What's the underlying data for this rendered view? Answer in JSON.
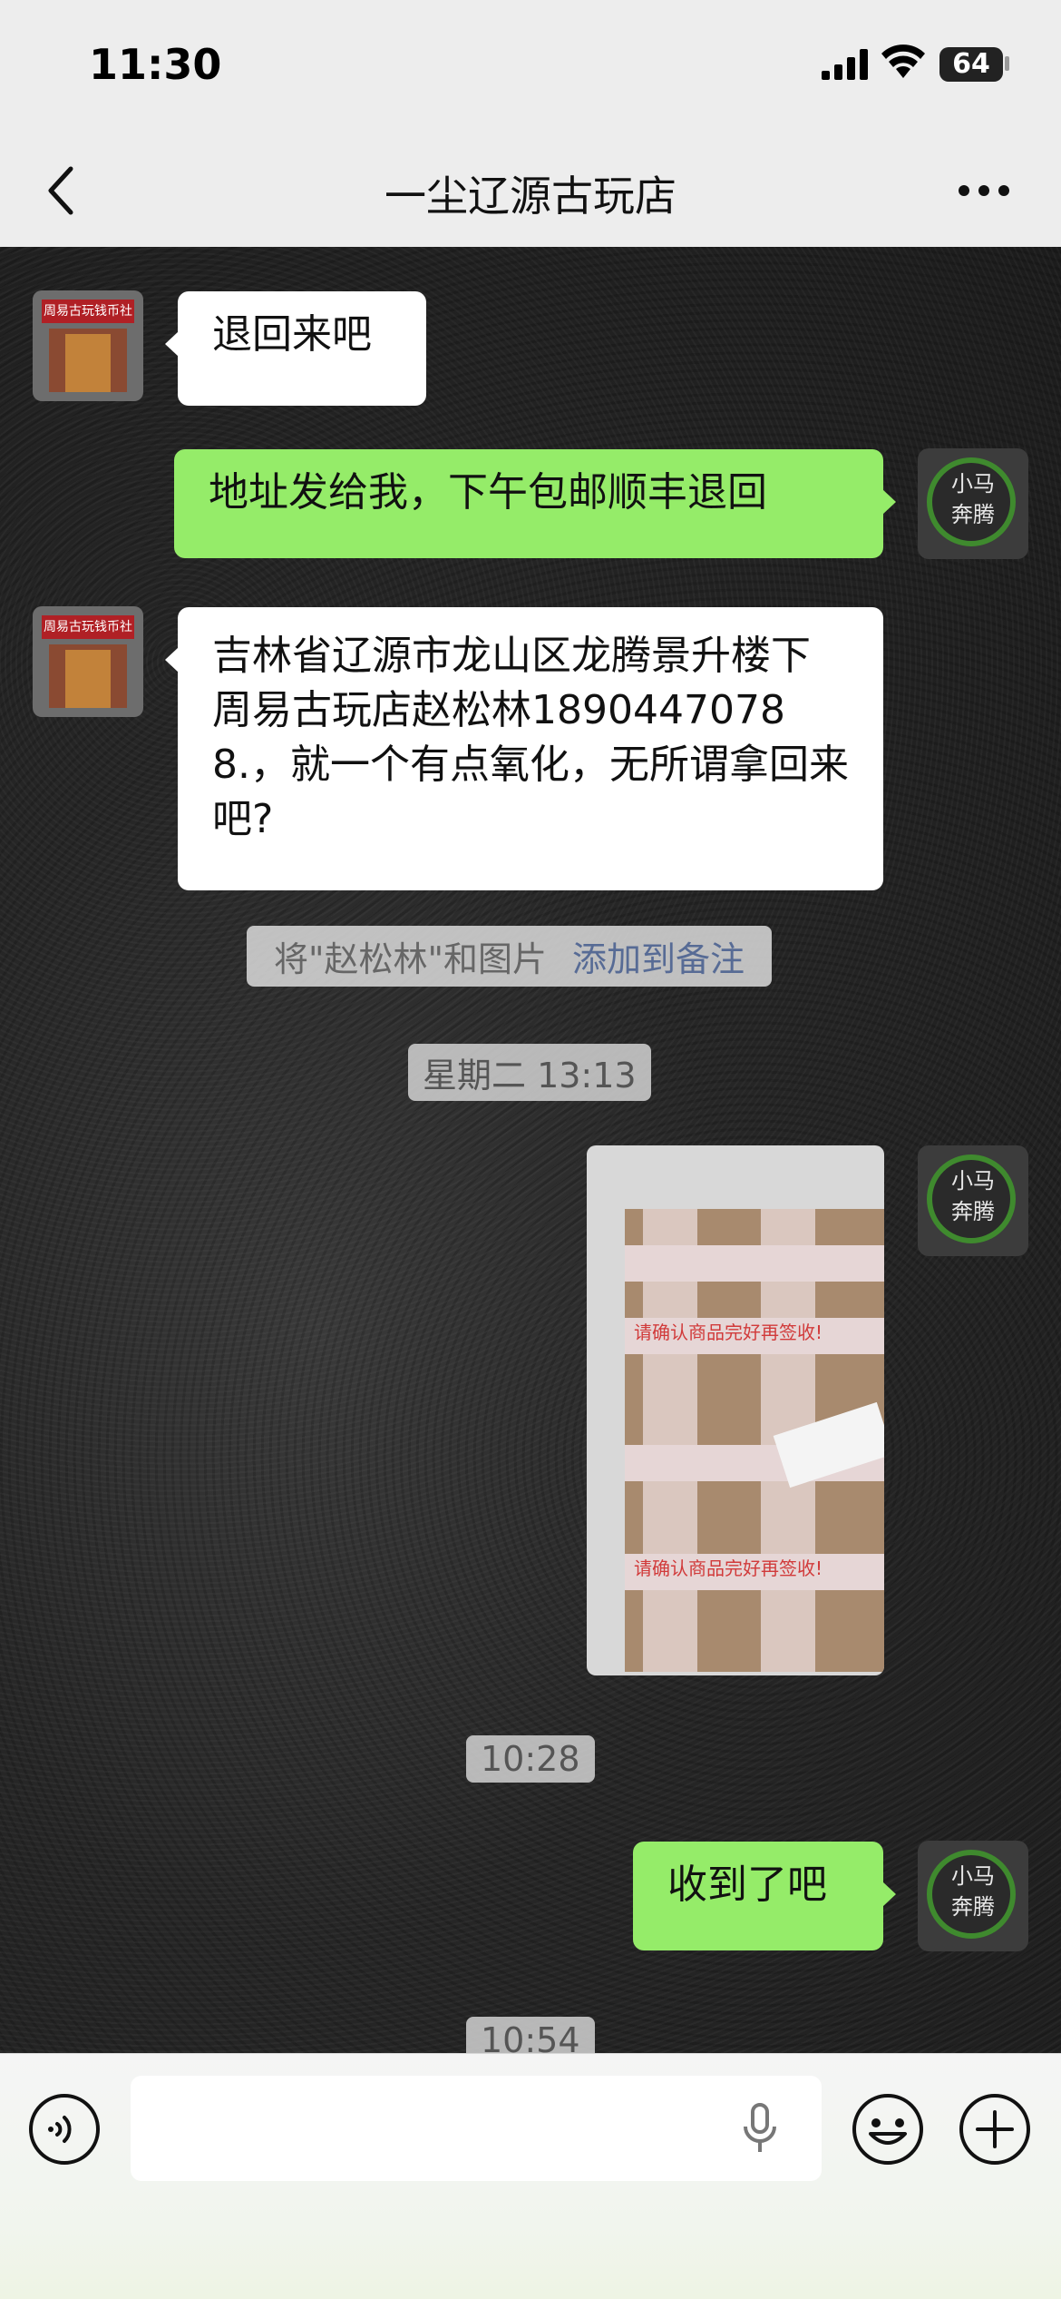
{
  "status": {
    "time": "11:30",
    "battery": "64"
  },
  "header": {
    "title": "一尘辽源古玩店"
  },
  "avatars": {
    "shop_sign": "周易古玩钱币社",
    "me_text_line1": "小马",
    "me_text_line2": "奔腾"
  },
  "messages": [
    {
      "side": "left",
      "text": "退回来吧"
    },
    {
      "side": "right",
      "text": "地址发给我，下午包邮顺丰退回"
    },
    {
      "side": "left",
      "text": "吉林省辽源市龙山区龙腾景升楼下周易古玩店赵松林18904470788.，就一个有点氧化，无所谓拿回来吧?"
    },
    {
      "side": "right",
      "text": "收到了吧"
    }
  ],
  "system_tip": {
    "text": "将\"赵松林\"和图片",
    "link": "添加到备注"
  },
  "timestamps": [
    "星期二 13:13",
    "10:28",
    "10:54"
  ],
  "photo": {
    "tape_text": "请确认商品完好再签收!"
  }
}
